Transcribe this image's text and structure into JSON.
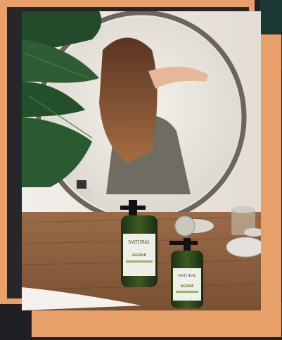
{
  "colors": {
    "frame_accent": "#e8a06a",
    "frame_dark": "#26272a",
    "background": "#1f2023"
  },
  "photo": {
    "bottle_large_label": {
      "brand": "NATURAL",
      "product": "AGAVE"
    },
    "bottle_small_label": {
      "brand": "NATURAL",
      "product": "AGAVE"
    }
  }
}
